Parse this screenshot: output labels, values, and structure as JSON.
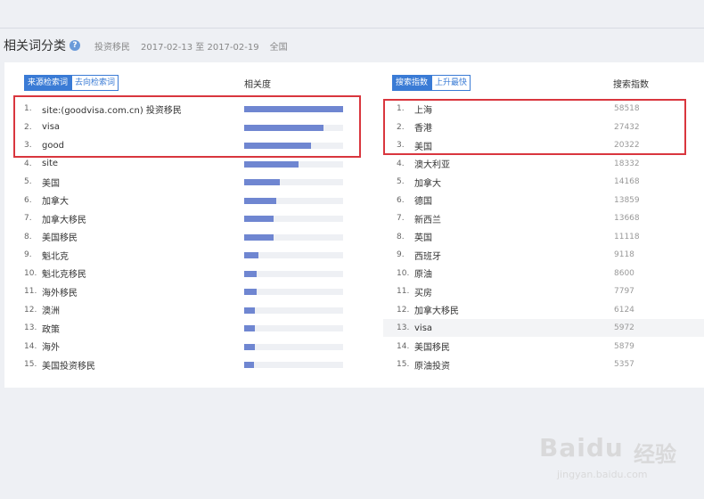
{
  "header": {
    "title": "相关词分类",
    "keyword": "投资移民",
    "date_range": "2017-02-13 至 2017-02-19",
    "region": "全国"
  },
  "left_panel": {
    "tabs": [
      {
        "label": "来源检索词",
        "active": true
      },
      {
        "label": "去向检索词",
        "active": false
      }
    ],
    "column_header": "相关度",
    "rows": [
      {
        "rank": "1.",
        "term": "site:(goodvisa.com.cn) 投资移民",
        "relevance": 1.0
      },
      {
        "rank": "2.",
        "term": "visa",
        "relevance": 0.8
      },
      {
        "rank": "3.",
        "term": "good",
        "relevance": 0.68
      },
      {
        "rank": "4.",
        "term": "site",
        "relevance": 0.55
      },
      {
        "rank": "5.",
        "term": "美国",
        "relevance": 0.36
      },
      {
        "rank": "6.",
        "term": "加拿大",
        "relevance": 0.32
      },
      {
        "rank": "7.",
        "term": "加拿大移民",
        "relevance": 0.3
      },
      {
        "rank": "8.",
        "term": "美国移民",
        "relevance": 0.3
      },
      {
        "rank": "9.",
        "term": "魁北克",
        "relevance": 0.14
      },
      {
        "rank": "10.",
        "term": "魁北克移民",
        "relevance": 0.13
      },
      {
        "rank": "11.",
        "term": "海外移民",
        "relevance": 0.13
      },
      {
        "rank": "12.",
        "term": "澳洲",
        "relevance": 0.11
      },
      {
        "rank": "13.",
        "term": "政策",
        "relevance": 0.11
      },
      {
        "rank": "14.",
        "term": "海外",
        "relevance": 0.11
      },
      {
        "rank": "15.",
        "term": "美国投资移民",
        "relevance": 0.1
      }
    ]
  },
  "right_panel": {
    "tabs": [
      {
        "label": "搜索指数",
        "active": true
      },
      {
        "label": "上升最快",
        "active": false
      }
    ],
    "column_header": "搜索指数",
    "rows": [
      {
        "rank": "1.",
        "term": "上海",
        "value": "58518"
      },
      {
        "rank": "2.",
        "term": "香港",
        "value": "27432"
      },
      {
        "rank": "3.",
        "term": "美国",
        "value": "20322"
      },
      {
        "rank": "4.",
        "term": "澳大利亚",
        "value": "18332"
      },
      {
        "rank": "5.",
        "term": "加拿大",
        "value": "14168"
      },
      {
        "rank": "6.",
        "term": "德国",
        "value": "13859"
      },
      {
        "rank": "7.",
        "term": "新西兰",
        "value": "13668"
      },
      {
        "rank": "8.",
        "term": "英国",
        "value": "11118"
      },
      {
        "rank": "9.",
        "term": "西班牙",
        "value": "9118"
      },
      {
        "rank": "10.",
        "term": "原油",
        "value": "8600"
      },
      {
        "rank": "11.",
        "term": "买房",
        "value": "7797"
      },
      {
        "rank": "12.",
        "term": "加拿大移民",
        "value": "6124"
      },
      {
        "rank": "13.",
        "term": "visa",
        "value": "5972"
      },
      {
        "rank": "14.",
        "term": "美国移民",
        "value": "5879"
      },
      {
        "rank": "15.",
        "term": "原油投资",
        "value": "5357"
      }
    ]
  },
  "watermark": {
    "brand": "Baidu",
    "brand_cn": "经验",
    "url": "jingyan.baidu.com"
  },
  "colors": {
    "accent": "#3a7bd5",
    "bar": "#6f86d1",
    "highlight_box": "#d9363e"
  }
}
